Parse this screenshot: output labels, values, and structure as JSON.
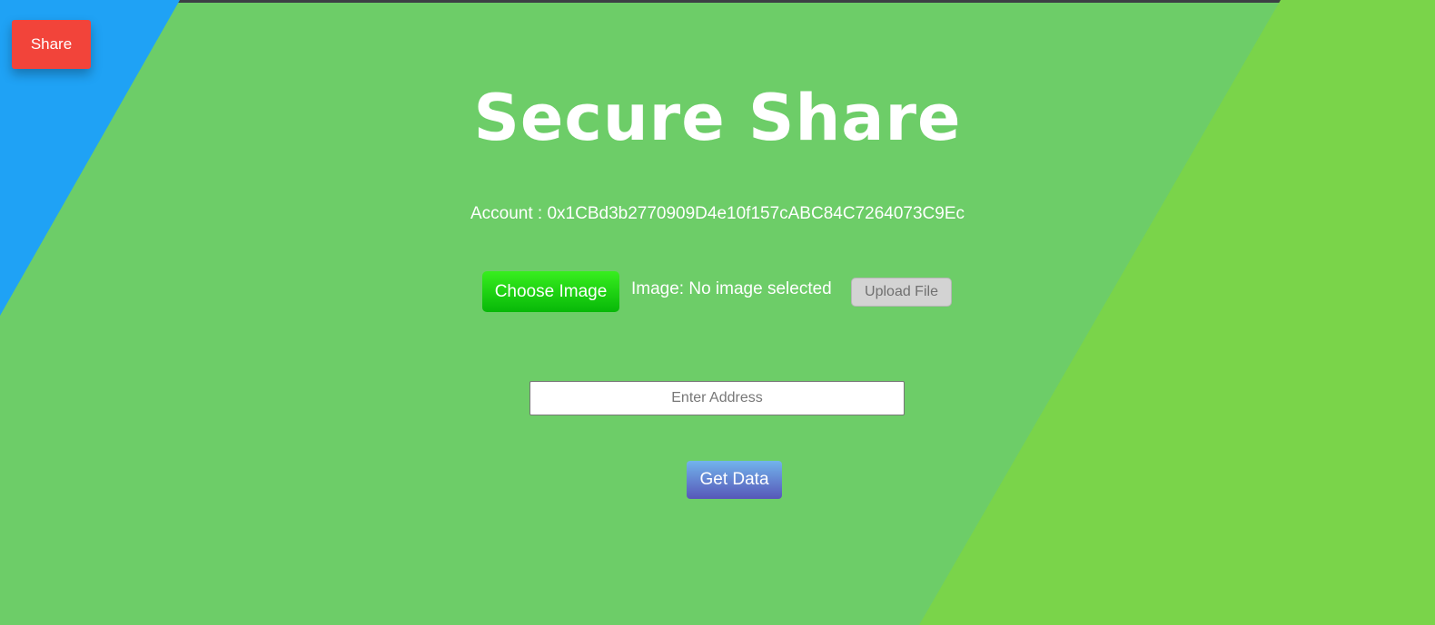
{
  "share_button": {
    "label": "Share"
  },
  "header": {
    "title": "Secure Share"
  },
  "account": {
    "text": "Account : 0x1CBd3b2770909D4e10f157cABC84C7264073C9Ec"
  },
  "file_picker": {
    "choose_label": "Choose Image",
    "status_text": "Image: No image selected",
    "upload_label": "Upload File"
  },
  "address_form": {
    "placeholder": "Enter Address",
    "value": "",
    "submit_label": "Get Data"
  },
  "colors": {
    "background_main": "#6dcd68",
    "background_left": "#1fa2f5",
    "background_right": "#7ad44a",
    "share_button": "#f2443a",
    "choose_button": "#1ed414",
    "get_data_button": "#6488d4"
  }
}
